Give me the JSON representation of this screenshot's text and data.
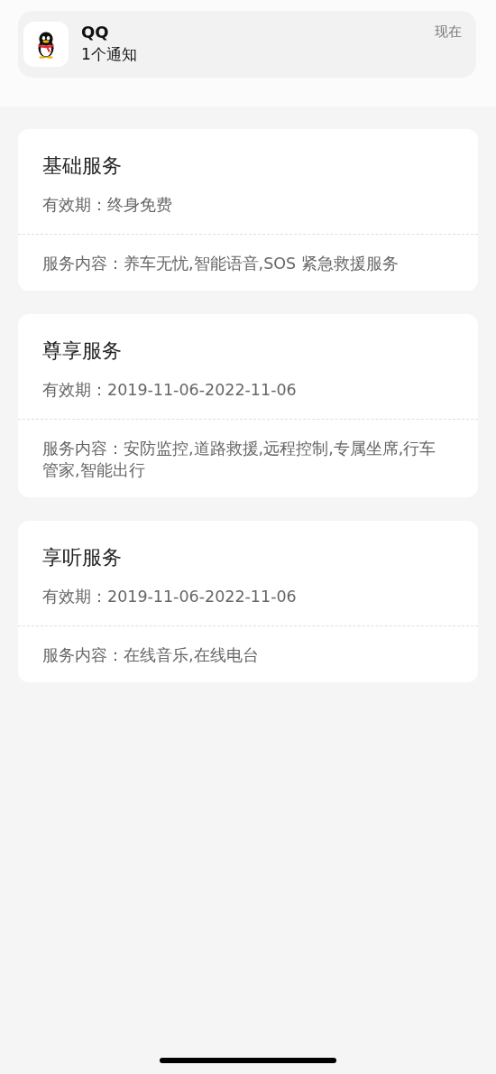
{
  "notification": {
    "app": "QQ",
    "message": "1个通知",
    "time": "现在"
  },
  "services": [
    {
      "title": "基础服务",
      "validity_label": "有效期：",
      "validity": "终身免费",
      "content_label": "服务内容：",
      "content": "养车无忧,智能语音,SOS 紧急救援服务"
    },
    {
      "title": "尊享服务",
      "validity_label": "有效期：",
      "validity": "2019-11-06-2022-11-06",
      "content_label": "服务内容：",
      "content": "安防监控,道路救援,远程控制,专属坐席,行车管家,智能出行"
    },
    {
      "title": "享听服务",
      "validity_label": "有效期：",
      "validity": "2019-11-06-2022-11-06",
      "content_label": "服务内容：",
      "content": "在线音乐,在线电台"
    }
  ]
}
